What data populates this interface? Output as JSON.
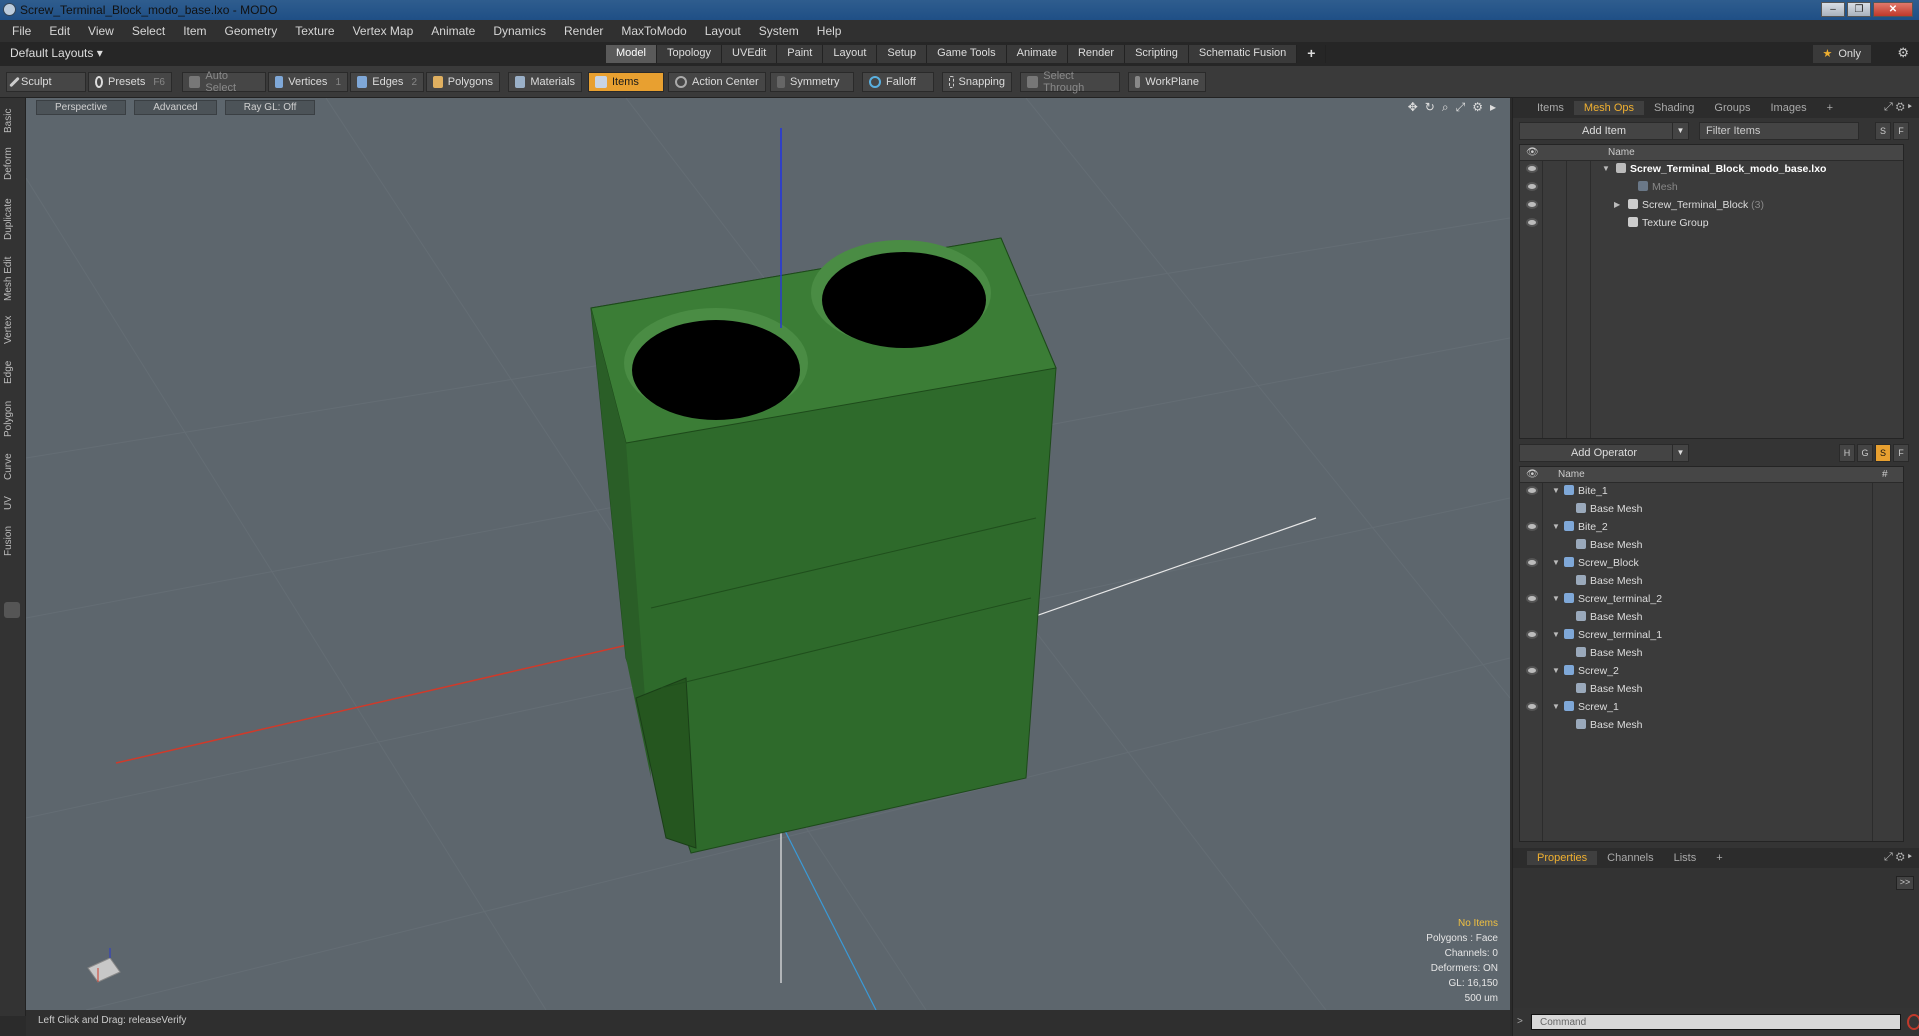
{
  "window": {
    "title": "Screw_Terminal_Block_modo_base.lxo - MODO",
    "min": "–",
    "max": "❐",
    "close": "✕"
  },
  "menu": [
    "File",
    "Edit",
    "View",
    "Select",
    "Item",
    "Geometry",
    "Texture",
    "Vertex Map",
    "Animate",
    "Dynamics",
    "Render",
    "MaxToModo",
    "Layout",
    "System",
    "Help"
  ],
  "layout": {
    "current": "Default Layouts ▾",
    "tabs": [
      "Model",
      "Topology",
      "UVEdit",
      "Paint",
      "Layout",
      "Setup",
      "Game Tools",
      "Animate",
      "Render",
      "Scripting",
      "Schematic Fusion"
    ],
    "active_tab": "Model",
    "plus": "+",
    "only": "Only",
    "gear": "⚙"
  },
  "toolbar": {
    "sculpt": "Sculpt",
    "presets": "Presets",
    "presets_key": "F6",
    "auto_select": "Auto Select",
    "vertices": "Vertices",
    "vertices_key": "1",
    "edges": "Edges",
    "edges_key": "2",
    "polygons": "Polygons",
    "materials": "Materials",
    "items": "Items",
    "action_center": "Action Center",
    "symmetry": "Symmetry",
    "falloff": "Falloff",
    "snapping": "Snapping",
    "select_through": "Select Through",
    "workplane": "WorkPlane"
  },
  "left_tabs": [
    "Basic",
    "Deform",
    "Duplicate",
    "Mesh Edit",
    "Vertex",
    "Edge",
    "Polygon",
    "Curve",
    "UV",
    "Fusion"
  ],
  "viewport": {
    "view": "Perspective",
    "shading": "Advanced",
    "raygl": "Ray GL: Off",
    "info": {
      "no_items": "No Items",
      "polygons": "Polygons : Face",
      "channels": "Channels: 0",
      "deformers": "Deformers: ON",
      "gl": "GL: 16,150",
      "scale": "500 um"
    },
    "colors": {
      "background": "#5d666d",
      "model": "#2f6b2a",
      "x_axis": "#d03a2a",
      "y_axis": "#2a3ad0",
      "z_axis": "#3a9ad8"
    }
  },
  "status": "Left Click and Drag:   releaseVerify",
  "items_panel": {
    "tabs": [
      "Items",
      "Mesh Ops",
      "Shading",
      "Groups",
      "Images"
    ],
    "active_tab": "Mesh Ops",
    "plus": "+",
    "add_item": "Add Item",
    "filter": "Filter Items",
    "s_btn": "S",
    "f_btn": "F",
    "col_name": "Name",
    "tree": [
      {
        "label": "Screw_Terminal_Block_modo_base.lxo",
        "indent": 0,
        "bold": true,
        "tri": "▼"
      },
      {
        "label": "Mesh",
        "indent": 1,
        "dim": true,
        "tri": ""
      },
      {
        "label": "Screw_Terminal_Block",
        "suffix": "(3)",
        "indent": 1,
        "tri": "▶"
      },
      {
        "label": "Texture Group",
        "indent": 1,
        "tri": ""
      }
    ]
  },
  "meshops_panel": {
    "add_operator": "Add Operator",
    "btns": [
      "H",
      "G",
      "S",
      "F"
    ],
    "col_name": "Name",
    "col_hash": "#",
    "ops": [
      {
        "name": "Bite_1",
        "child": "Base Mesh"
      },
      {
        "name": "Bite_2",
        "child": "Base Mesh"
      },
      {
        "name": "Screw_Block",
        "child": "Base Mesh"
      },
      {
        "name": "Screw_terminal_2",
        "child": "Base Mesh"
      },
      {
        "name": "Screw_terminal_1",
        "child": "Base Mesh"
      },
      {
        "name": "Screw_2",
        "child": "Base Mesh"
      },
      {
        "name": "Screw_1",
        "child": "Base Mesh"
      }
    ]
  },
  "properties_panel": {
    "tabs": [
      "Properties",
      "Channels",
      "Lists"
    ],
    "active_tab": "Properties",
    "plus": "+",
    "expand": ">>",
    "command_placeholder": "Command"
  }
}
